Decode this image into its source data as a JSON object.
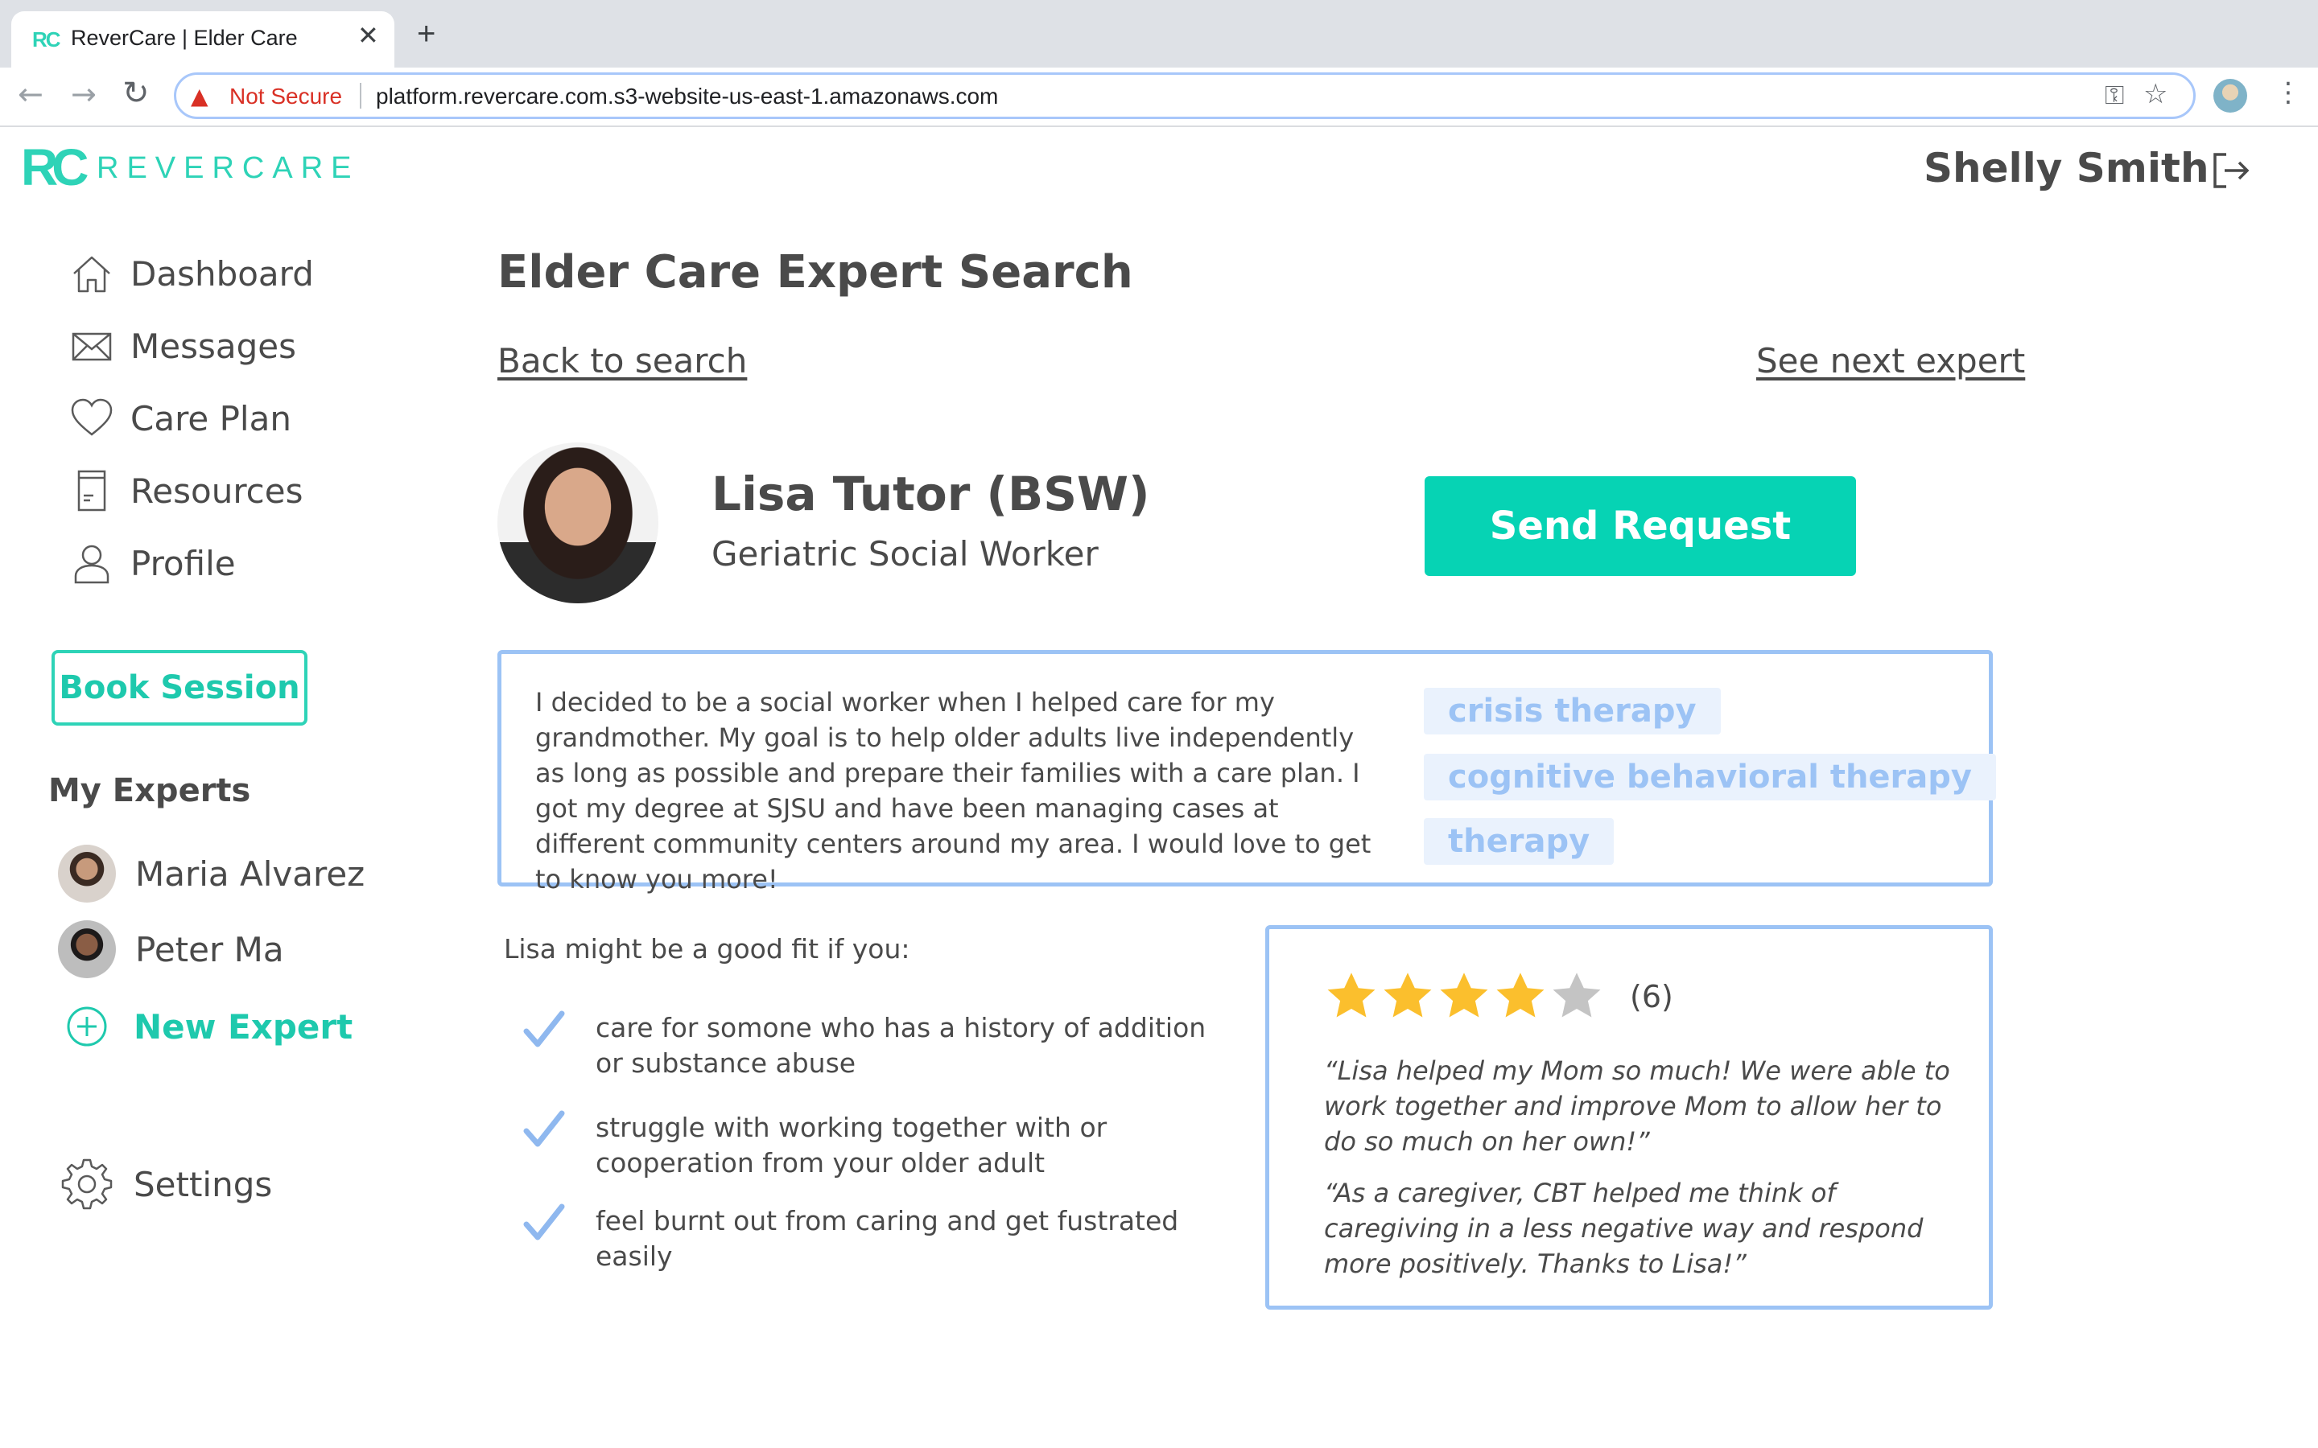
{
  "browser": {
    "tab_favicon": "RC",
    "tab_title": "ReverCare | Elder Care",
    "tab_close": "✕",
    "new_tab": "+",
    "security_label": "Not Secure",
    "url": "platform.revercare.com.s3-website-us-east-1.amazonaws.com"
  },
  "header": {
    "logo_mark": "RC",
    "logo_word": "REVERCARE",
    "user_name": "Shelly Smith"
  },
  "sidebar": {
    "items": [
      {
        "label": "Dashboard",
        "icon": "home-icon"
      },
      {
        "label": "Messages",
        "icon": "envelope-icon"
      },
      {
        "label": "Care Plan",
        "icon": "heart-icon"
      },
      {
        "label": "Resources",
        "icon": "document-icon"
      },
      {
        "label": "Profile",
        "icon": "person-icon"
      }
    ],
    "book_session": "Book Session",
    "my_experts_title": "My Experts",
    "experts": [
      {
        "name": "Maria Alvarez"
      },
      {
        "name": "Peter Ma"
      }
    ],
    "new_expert": "New Expert",
    "settings": "Settings"
  },
  "main": {
    "title": "Elder Care Expert Search",
    "back_link": "Back to search",
    "next_link": "See next expert",
    "expert": {
      "name": "Lisa Tutor (BSW)",
      "role": "Geriatric Social Worker"
    },
    "send_request": "Send Request",
    "bio": "I decided to be a social worker when I helped care for my grandmother. My goal is to help older adults live independently as long as possible and prepare their families with a care plan. I got my degree at SJSU and have been managing cases at different community centers around my area. I would love to get to know you more!",
    "tags": [
      "crisis therapy",
      "cognitive behavioral therapy",
      "therapy"
    ],
    "fit_title": "Lisa might be a good fit if you:",
    "fit_items": [
      "care for somone who has a history of addition or substance abuse",
      "struggle with working together with or cooperation from your older adult",
      "feel burnt out from caring and get fustrated easily"
    ],
    "rating": {
      "stars": 4,
      "max": 5,
      "count_label": "(6)"
    },
    "reviews": [
      "“Lisa helped my Mom so much! We were able to work together and improve Mom to allow her to do so much on her own!”",
      "“As a caregiver, CBT helped me think of caregiving in a less negative way and respond more positively. Thanks to Lisa!”"
    ]
  },
  "colors": {
    "brand": "#2ed3b7",
    "button": "#06d3b4",
    "box_border": "#9cc3f5",
    "tag_bg": "#eaf2fd",
    "star_filled": "#fbbf2d",
    "star_empty": "#c4c4c4",
    "warning": "#d93025"
  }
}
